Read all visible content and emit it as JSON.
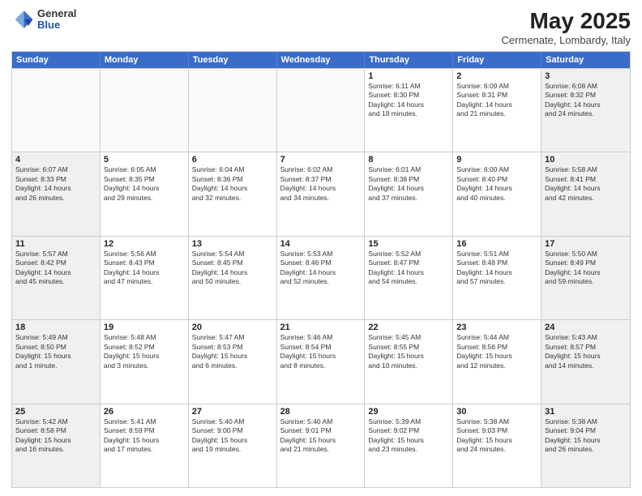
{
  "header": {
    "logo_general": "General",
    "logo_blue": "Blue",
    "month_year": "May 2025",
    "location": "Cermenate, Lombardy, Italy"
  },
  "weekdays": [
    "Sunday",
    "Monday",
    "Tuesday",
    "Wednesday",
    "Thursday",
    "Friday",
    "Saturday"
  ],
  "rows": [
    [
      {
        "day": "",
        "text": "",
        "empty": true
      },
      {
        "day": "",
        "text": "",
        "empty": true
      },
      {
        "day": "",
        "text": "",
        "empty": true
      },
      {
        "day": "",
        "text": "",
        "empty": true
      },
      {
        "day": "1",
        "text": "Sunrise: 6:11 AM\nSunset: 8:30 PM\nDaylight: 14 hours\nand 18 minutes.",
        "empty": false
      },
      {
        "day": "2",
        "text": "Sunrise: 6:09 AM\nSunset: 8:31 PM\nDaylight: 14 hours\nand 21 minutes.",
        "empty": false
      },
      {
        "day": "3",
        "text": "Sunrise: 6:08 AM\nSunset: 8:32 PM\nDaylight: 14 hours\nand 24 minutes.",
        "empty": false
      }
    ],
    [
      {
        "day": "4",
        "text": "Sunrise: 6:07 AM\nSunset: 8:33 PM\nDaylight: 14 hours\nand 26 minutes.",
        "empty": false
      },
      {
        "day": "5",
        "text": "Sunrise: 6:05 AM\nSunset: 8:35 PM\nDaylight: 14 hours\nand 29 minutes.",
        "empty": false
      },
      {
        "day": "6",
        "text": "Sunrise: 6:04 AM\nSunset: 8:36 PM\nDaylight: 14 hours\nand 32 minutes.",
        "empty": false
      },
      {
        "day": "7",
        "text": "Sunrise: 6:02 AM\nSunset: 8:37 PM\nDaylight: 14 hours\nand 34 minutes.",
        "empty": false
      },
      {
        "day": "8",
        "text": "Sunrise: 6:01 AM\nSunset: 8:38 PM\nDaylight: 14 hours\nand 37 minutes.",
        "empty": false
      },
      {
        "day": "9",
        "text": "Sunrise: 6:00 AM\nSunset: 8:40 PM\nDaylight: 14 hours\nand 40 minutes.",
        "empty": false
      },
      {
        "day": "10",
        "text": "Sunrise: 5:58 AM\nSunset: 8:41 PM\nDaylight: 14 hours\nand 42 minutes.",
        "empty": false
      }
    ],
    [
      {
        "day": "11",
        "text": "Sunrise: 5:57 AM\nSunset: 8:42 PM\nDaylight: 14 hours\nand 45 minutes.",
        "empty": false
      },
      {
        "day": "12",
        "text": "Sunrise: 5:56 AM\nSunset: 8:43 PM\nDaylight: 14 hours\nand 47 minutes.",
        "empty": false
      },
      {
        "day": "13",
        "text": "Sunrise: 5:54 AM\nSunset: 8:45 PM\nDaylight: 14 hours\nand 50 minutes.",
        "empty": false
      },
      {
        "day": "14",
        "text": "Sunrise: 5:53 AM\nSunset: 8:46 PM\nDaylight: 14 hours\nand 52 minutes.",
        "empty": false
      },
      {
        "day": "15",
        "text": "Sunrise: 5:52 AM\nSunset: 8:47 PM\nDaylight: 14 hours\nand 54 minutes.",
        "empty": false
      },
      {
        "day": "16",
        "text": "Sunrise: 5:51 AM\nSunset: 8:48 PM\nDaylight: 14 hours\nand 57 minutes.",
        "empty": false
      },
      {
        "day": "17",
        "text": "Sunrise: 5:50 AM\nSunset: 8:49 PM\nDaylight: 14 hours\nand 59 minutes.",
        "empty": false
      }
    ],
    [
      {
        "day": "18",
        "text": "Sunrise: 5:49 AM\nSunset: 8:50 PM\nDaylight: 15 hours\nand 1 minute.",
        "empty": false
      },
      {
        "day": "19",
        "text": "Sunrise: 5:48 AM\nSunset: 8:52 PM\nDaylight: 15 hours\nand 3 minutes.",
        "empty": false
      },
      {
        "day": "20",
        "text": "Sunrise: 5:47 AM\nSunset: 8:53 PM\nDaylight: 15 hours\nand 6 minutes.",
        "empty": false
      },
      {
        "day": "21",
        "text": "Sunrise: 5:46 AM\nSunset: 8:54 PM\nDaylight: 15 hours\nand 8 minutes.",
        "empty": false
      },
      {
        "day": "22",
        "text": "Sunrise: 5:45 AM\nSunset: 8:55 PM\nDaylight: 15 hours\nand 10 minutes.",
        "empty": false
      },
      {
        "day": "23",
        "text": "Sunrise: 5:44 AM\nSunset: 8:56 PM\nDaylight: 15 hours\nand 12 minutes.",
        "empty": false
      },
      {
        "day": "24",
        "text": "Sunrise: 5:43 AM\nSunset: 8:57 PM\nDaylight: 15 hours\nand 14 minutes.",
        "empty": false
      }
    ],
    [
      {
        "day": "25",
        "text": "Sunrise: 5:42 AM\nSunset: 8:58 PM\nDaylight: 15 hours\nand 16 minutes.",
        "empty": false
      },
      {
        "day": "26",
        "text": "Sunrise: 5:41 AM\nSunset: 8:59 PM\nDaylight: 15 hours\nand 17 minutes.",
        "empty": false
      },
      {
        "day": "27",
        "text": "Sunrise: 5:40 AM\nSunset: 9:00 PM\nDaylight: 15 hours\nand 19 minutes.",
        "empty": false
      },
      {
        "day": "28",
        "text": "Sunrise: 5:40 AM\nSunset: 9:01 PM\nDaylight: 15 hours\nand 21 minutes.",
        "empty": false
      },
      {
        "day": "29",
        "text": "Sunrise: 5:39 AM\nSunset: 9:02 PM\nDaylight: 15 hours\nand 23 minutes.",
        "empty": false
      },
      {
        "day": "30",
        "text": "Sunrise: 5:38 AM\nSunset: 9:03 PM\nDaylight: 15 hours\nand 24 minutes.",
        "empty": false
      },
      {
        "day": "31",
        "text": "Sunrise: 5:38 AM\nSunset: 9:04 PM\nDaylight: 15 hours\nand 26 minutes.",
        "empty": false
      }
    ]
  ]
}
